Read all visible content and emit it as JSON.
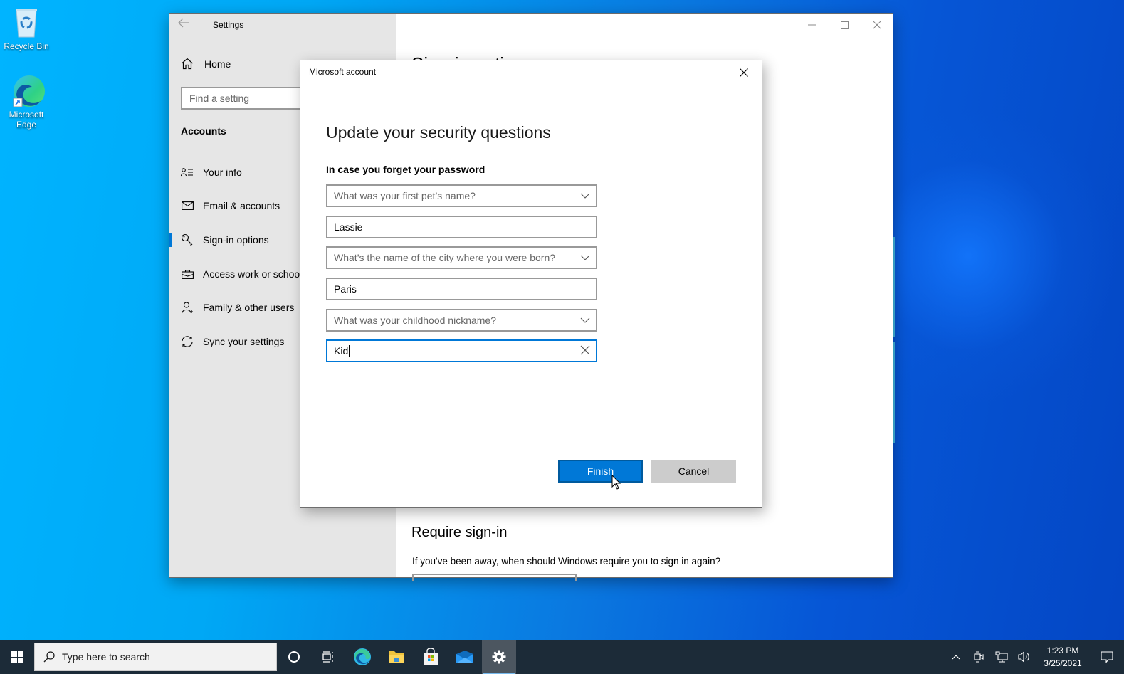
{
  "desktop": {
    "icons": [
      {
        "label": "Recycle Bin",
        "icon": "recycle-bin-icon"
      },
      {
        "label_line1": "Microsoft",
        "label_line2": "Edge",
        "icon": "edge-icon"
      }
    ]
  },
  "settings": {
    "title": "Settings",
    "home_label": "Home",
    "search_placeholder": "Find a setting",
    "section_label": "Accounts",
    "nav": [
      {
        "label": "Your info",
        "icon": "contact-info-icon",
        "active": false
      },
      {
        "label": "Email & accounts",
        "icon": "mail-icon",
        "active": false
      },
      {
        "label": "Sign-in options",
        "icon": "key-icon",
        "active": true
      },
      {
        "label": "Access work or school",
        "icon": "briefcase-icon",
        "active": false
      },
      {
        "label": "Family & other users",
        "icon": "add-person-icon",
        "active": false
      },
      {
        "label": "Sync your settings",
        "icon": "sync-icon",
        "active": false
      }
    ],
    "main_heading": "Sign-in options",
    "require_signin_heading": "Require sign-in",
    "require_signin_text": "If you've been away, when should Windows require you to sign in again?"
  },
  "dialog": {
    "window_title": "Microsoft account",
    "heading": "Update your security questions",
    "subheading": "In case you forget your password",
    "questions": [
      {
        "question": "What was your first pet’s name?",
        "answer": "Lassie"
      },
      {
        "question": "What’s the name of the city where you were born?",
        "answer": "Paris"
      },
      {
        "question": "What was your childhood nickname?",
        "answer": "Kid"
      }
    ],
    "finish_label": "Finish",
    "cancel_label": "Cancel",
    "accent_color": "#0078d7"
  },
  "taskbar": {
    "search_placeholder": "Type here to search",
    "apps": [
      "cortana-icon",
      "task-view-icon",
      "edge-icon",
      "file-explorer-icon",
      "store-icon",
      "mail-icon",
      "settings-icon"
    ],
    "active_app": "settings-icon",
    "time": "1:23 PM",
    "date": "3/25/2021"
  }
}
